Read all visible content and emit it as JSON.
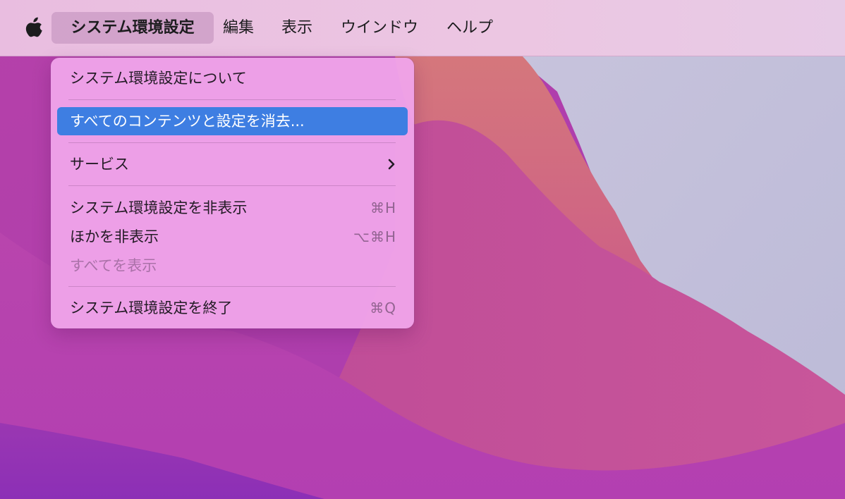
{
  "menubar": {
    "apple_icon": "apple-logo-icon",
    "app_menu": "システム環境設定",
    "items": [
      "編集",
      "表示",
      "ウインドウ",
      "ヘルプ"
    ]
  },
  "dropdown": {
    "about": "システム環境設定について",
    "erase": "すべてのコンテンツと設定を消去...",
    "services": "サービス",
    "hide": {
      "label": "システム環境設定を非表示",
      "shortcut": "⌘H"
    },
    "hide_others": {
      "label": "ほかを非表示",
      "shortcut": "⌥⌘H"
    },
    "show_all": "すべてを表示",
    "quit": {
      "label": "システム環境設定を終了",
      "shortcut": "⌘Q"
    }
  },
  "colors": {
    "highlight": "#3e7ee2",
    "menu_background": "#efa3e9",
    "menubar_background": "#ecc6e2"
  }
}
